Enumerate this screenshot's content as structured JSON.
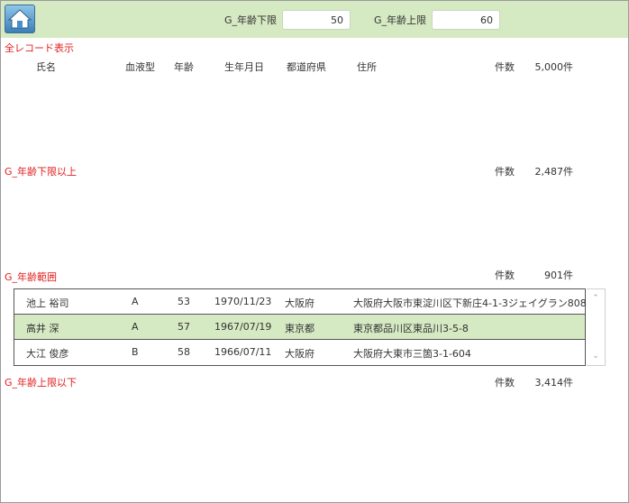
{
  "toolbar": {
    "lower_label": "G_年齢下限",
    "lower_value": "50",
    "upper_label": "G_年齢上限",
    "upper_value": "60"
  },
  "sections": {
    "all": {
      "label": "全レコード表示",
      "count_label": "件数",
      "count": "5,000件"
    },
    "lower": {
      "label": "G_年齢下限以上",
      "count_label": "件数",
      "count": "2,487件"
    },
    "range": {
      "label": "G_年齢範囲",
      "count_label": "件数",
      "count": "901件"
    },
    "upper": {
      "label": "G_年齢上限以下",
      "count_label": "件数",
      "count": "3,414件"
    }
  },
  "headers": {
    "name": "氏名",
    "blood": "血液型",
    "age": "年齢",
    "birth": "生年月日",
    "pref": "都道府県",
    "address": "住所"
  },
  "rows": [
    {
      "name": "池上 裕司",
      "blood": "A",
      "age": "53",
      "birth": "1970/11/23",
      "pref": "大阪府",
      "address": "大阪府大阪市東淀川区下新庄4-1-3ジェイグラン808"
    },
    {
      "name": "高井 深",
      "blood": "A",
      "age": "57",
      "birth": "1967/07/19",
      "pref": "東京都",
      "address": "東京都品川区東品川3-5-8"
    },
    {
      "name": "大江 俊彦",
      "blood": "B",
      "age": "58",
      "birth": "1966/07/11",
      "pref": "大阪府",
      "address": "大阪府大東市三箇3-1-604"
    }
  ],
  "colors": {
    "toolbar_bg": "#d5e9c2",
    "section_label": "#e02020",
    "selected_row": "#d5e9c2"
  }
}
